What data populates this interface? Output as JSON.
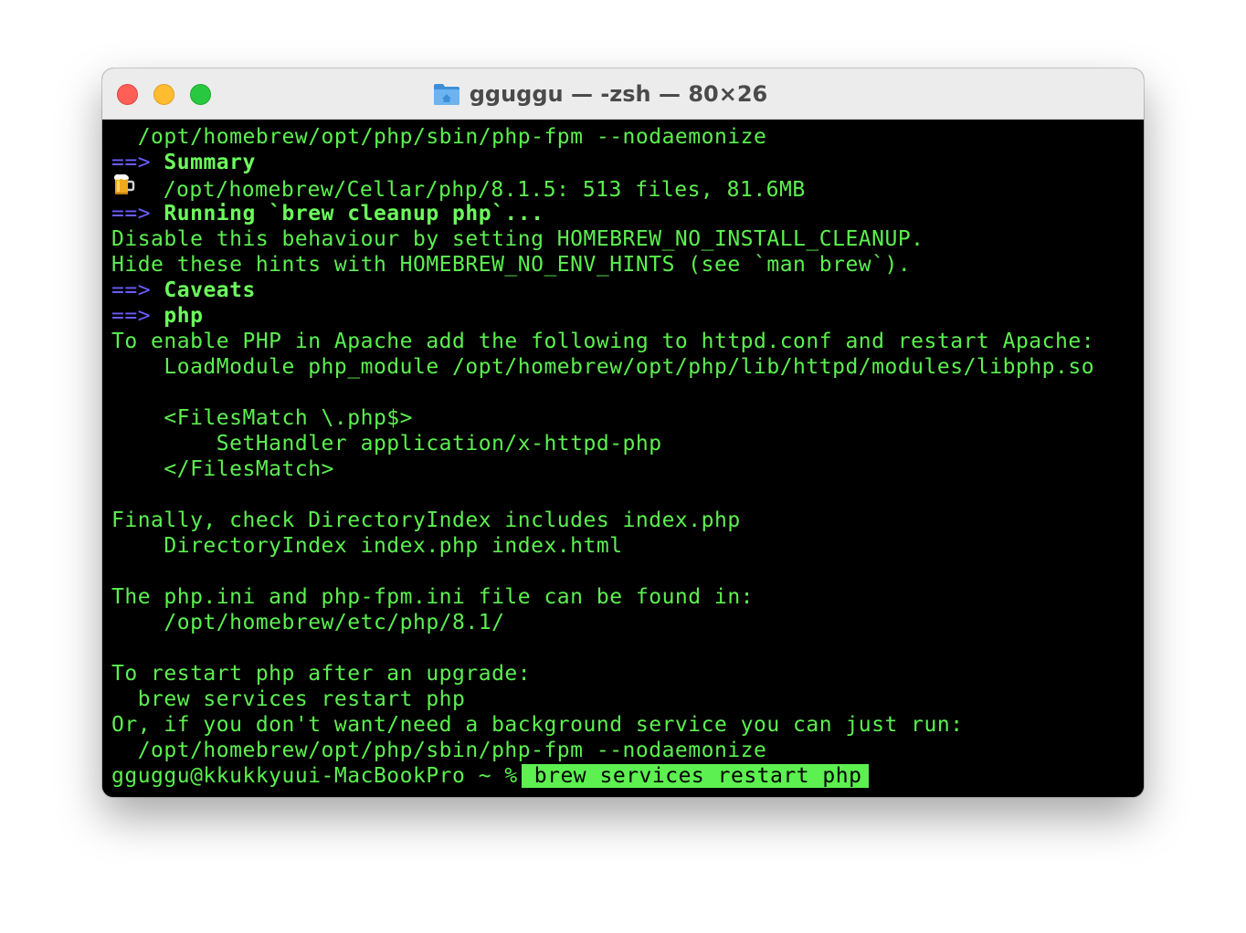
{
  "window": {
    "title": "gguggu — -zsh — 80×26",
    "folder_icon": "folder-icon"
  },
  "terminal": {
    "line01": "  /opt/homebrew/opt/php/sbin/php-fpm --nodaemonize",
    "arrow": "==>",
    "summary": "Summary",
    "beer_icon": "beer-mug-icon",
    "line03_text": "/opt/homebrew/Cellar/php/8.1.5: 513 files, 81.6MB",
    "cleanup": "Running `brew cleanup php`...",
    "line05": "Disable this behaviour by setting HOMEBREW_NO_INSTALL_CLEANUP.",
    "line06": "Hide these hints with HOMEBREW_NO_ENV_HINTS (see `man brew`).",
    "caveats": "Caveats",
    "php": "php",
    "line09": "To enable PHP in Apache add the following to httpd.conf and restart Apache:",
    "line10": "    LoadModule php_module /opt/homebrew/opt/php/lib/httpd/modules/libphp.so",
    "line12": "    <FilesMatch \\.php$>",
    "line13": "        SetHandler application/x-httpd-php",
    "line14": "    </FilesMatch>",
    "line16": "Finally, check DirectoryIndex includes index.php",
    "line17": "    DirectoryIndex index.php index.html",
    "line19": "The php.ini and php-fpm.ini file can be found in:",
    "line20": "    /opt/homebrew/etc/php/8.1/",
    "line22": "To restart php after an upgrade:",
    "line23": "  brew services restart php",
    "line24": "Or, if you don't want/need a background service you can just run:",
    "line25": "  /opt/homebrew/opt/php/sbin/php-fpm --nodaemonize",
    "prompt": "gguggu@kkukkyuui-MacBookPro ~ %",
    "command": "brew services restart php"
  },
  "colors": {
    "text": "#5cf050",
    "arrow": "#6a5cff",
    "background": "#000000"
  }
}
